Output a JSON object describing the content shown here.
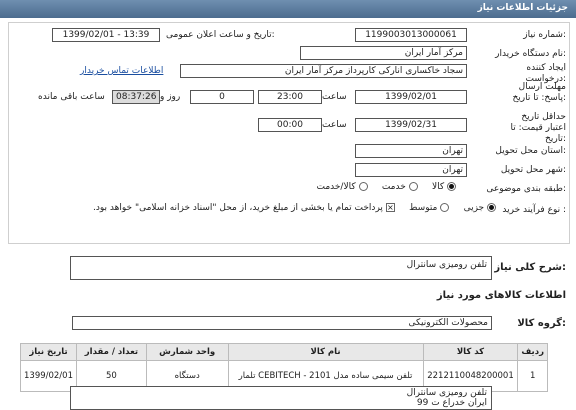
{
  "header": {
    "title": "جزئیات اطلاعات نیاز"
  },
  "form": {
    "need_number_label": "شماره نیاز:",
    "need_number": "1199003013000061",
    "announce_label": "تاریخ و ساعت اعلان عمومی:",
    "announce_value": "1399/02/01 - 13:39",
    "buyer_org_label": "نام دستگاه خریدار:",
    "buyer_org": "مرکز آمار ایران",
    "creator_label": "ایجاد کننده درخواست:",
    "creator": "سجاد خاکساری انارکی کارپرداز مرکز آمار ایران",
    "contact_link": "اطلاعات تماس خریدار",
    "reply_deadline_label": "مهلت ارسال پاسخ: تا تاریخ:",
    "reply_date": "1399/02/01",
    "time_label": "ساعت",
    "reply_time": "23:00",
    "days_value": "0",
    "days_label": "روز و",
    "remaining_time": "08:37:26",
    "remaining_label": "ساعت باقی مانده",
    "validity_label": "حداقل تاریخ اعتبار قیمت: تا تاریخ:",
    "validity_date": "1399/02/31",
    "validity_time": "00:00",
    "province_label": "استان محل تحویل:",
    "province": "تهران",
    "city_label": "شهر محل تحویل:",
    "city": "تهران",
    "category_label": "طبقه بندی موضوعی:",
    "category_options": [
      "کالا",
      "خدمت",
      "کالا/خدمت"
    ],
    "process_label": "نوع فرآیند خرید :",
    "process_options": [
      "جزیی",
      "متوسط"
    ],
    "payment_note": "پرداخت تمام یا بخشی از مبلغ خرید، از محل \"اسناد خزانه اسلامی\" خواهد بود."
  },
  "summary": {
    "label": "شرح کلی نیاز:",
    "value": "تلفن رومیزی سانترال"
  },
  "goods": {
    "section_title": "اطلاعات کالاهای مورد نیاز",
    "group_label": "گروه کالا:",
    "group_value": "محصولات الکترونیکی",
    "columns": [
      "ردیف",
      "کد کالا",
      "نام کالا",
      "واحد شمارش",
      "تعداد / مقدار",
      "تاریخ نیاز"
    ],
    "rows": [
      [
        "1",
        "2212110048200001",
        "تلفن سیمی ساده مدل CEBITECH - 2101 تلمار",
        "دستگاه",
        "50",
        "1399/02/01"
      ]
    ]
  },
  "notes": {
    "line1": "تلفن رومیزی سانترال",
    "line2": "ایران خدراع ت 99"
  }
}
